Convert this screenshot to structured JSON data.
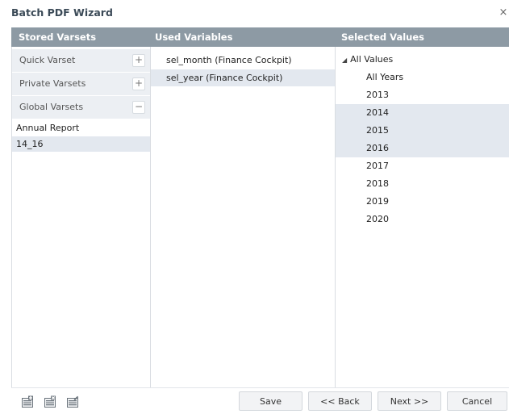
{
  "window": {
    "title": "Batch PDF Wizard",
    "close_label": "×"
  },
  "columns": {
    "stored_varsets": "Stored Varsets",
    "used_variables": "Used Variables",
    "selected_values": "Selected Values"
  },
  "stored_varsets": {
    "sections": [
      {
        "label": "Quick Varset",
        "toggle": "+"
      },
      {
        "label": "Private Varsets",
        "toggle": "+"
      },
      {
        "label": "Global Varsets",
        "toggle": "−"
      }
    ],
    "global_items": [
      "Annual Report",
      "14_16"
    ]
  },
  "used_variables": {
    "items": [
      "sel_month (Finance Cockpit)",
      "sel_year (Finance Cockpit)"
    ]
  },
  "selected_values": {
    "root": "All Values",
    "items": [
      "All Years",
      "2013",
      "2014",
      "2015",
      "2016",
      "2017",
      "2018",
      "2019",
      "2020"
    ]
  },
  "footer": {
    "save": "Save",
    "back": "<< Back",
    "next": "Next >>",
    "cancel": "Cancel"
  },
  "colors": {
    "header_bg": "#8d9aa4",
    "selection_bg": "#e3e8ef",
    "accordion_bg": "#eceff3"
  }
}
